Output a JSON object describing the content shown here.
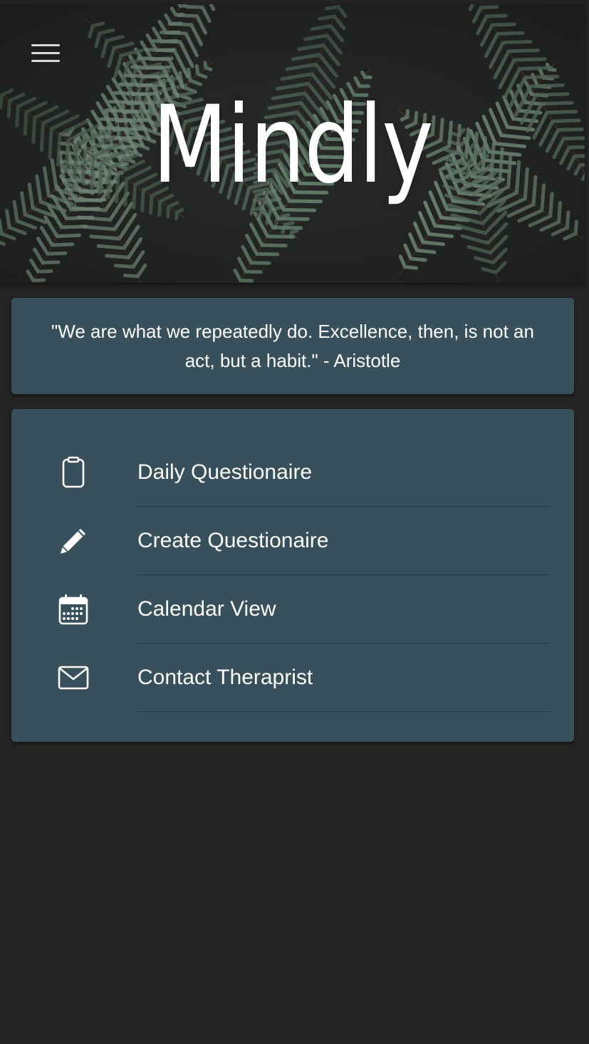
{
  "app": {
    "title": "Mindly"
  },
  "header": {
    "menu_icon": "hamburger-menu-icon"
  },
  "quote": {
    "text": "\"We are what we repeatedly do. Excellence, then, is not an act, but a habit.\" - Aristotle"
  },
  "menu": {
    "items": [
      {
        "label": "Daily Questionaire",
        "icon": "clipboard-icon"
      },
      {
        "label": "Create Questionaire",
        "icon": "pencil-icon"
      },
      {
        "label": "Calendar View",
        "icon": "calendar-icon"
      },
      {
        "label": "Contact Theraprist",
        "icon": "mail-icon"
      }
    ]
  },
  "colors": {
    "background": "#242424",
    "card": "#37505c",
    "text": "#ffffff"
  }
}
